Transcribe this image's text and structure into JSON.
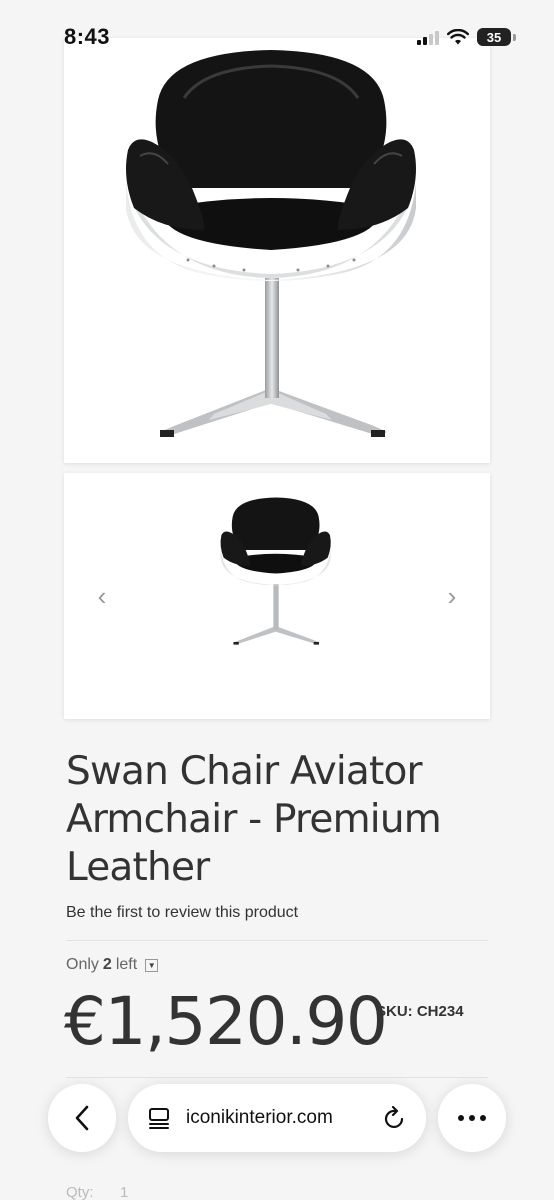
{
  "status_bar": {
    "time": "8:43",
    "battery": "35"
  },
  "gallery": {
    "prev_glyph": "‹",
    "next_glyph": "›"
  },
  "product": {
    "title": "Swan Chair Aviator Armchair - Premium Leather",
    "review_link": "Be the first to review this product",
    "stock_prefix": "Only",
    "stock_count": "2",
    "stock_suffix": "left",
    "price": "€1,520.90",
    "sku_label": "SKU:",
    "sku_value": "CH234"
  },
  "form_partial": {
    "qty_label": "Qty:",
    "qty_value": "1"
  },
  "browser": {
    "url": "iconikinterior.com"
  },
  "colors": {
    "background": "#f5f5f5",
    "text": "#333333",
    "leather": "#141414",
    "aluminium": "#cfd2d4"
  }
}
